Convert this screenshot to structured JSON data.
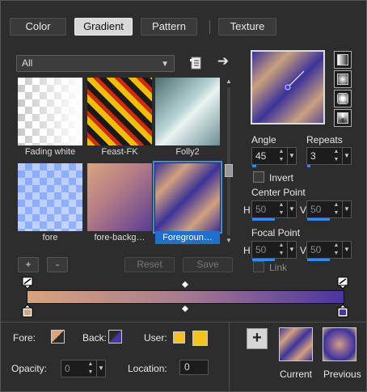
{
  "tabs": [
    "Color",
    "Gradient",
    "Pattern",
    "Texture"
  ],
  "active_tab": "Gradient",
  "category": {
    "value": "All"
  },
  "gradients": [
    {
      "label": "Fading white"
    },
    {
      "label": "Feast-FK"
    },
    {
      "label": "Folly2"
    },
    {
      "label": "fore"
    },
    {
      "label": "fore-backg…"
    },
    {
      "label": "Foregroun…",
      "selected": true
    }
  ],
  "list_buttons": {
    "add": "+",
    "remove": "-",
    "reset": "Reset",
    "save": "Save"
  },
  "angle": {
    "label": "Angle",
    "value": "45"
  },
  "repeats": {
    "label": "Repeats",
    "value": "3"
  },
  "invert": {
    "label": "Invert",
    "checked": false
  },
  "center_point": {
    "label": "Center Point",
    "h_label": "H",
    "h": "50",
    "v_label": "V",
    "v": "50"
  },
  "focal_point": {
    "label": "Focal Point",
    "h_label": "H",
    "h": "50",
    "v_label": "V",
    "v": "50"
  },
  "link": {
    "label": "Link",
    "checked": false
  },
  "bottom": {
    "fore_label": "Fore:",
    "back_label": "Back:",
    "user_label": "User:",
    "opacity_label": "Opacity:",
    "opacity_value": "0",
    "location_label": "Location:",
    "location_value": "0",
    "current_label": "Current",
    "previous_label": "Previous",
    "add_label": "+"
  },
  "colors": {
    "accent": "#3b8ee8",
    "gradient_start": "#d8a47c",
    "gradient_end": "#4a35a0",
    "user_color": "#f4c21d"
  }
}
